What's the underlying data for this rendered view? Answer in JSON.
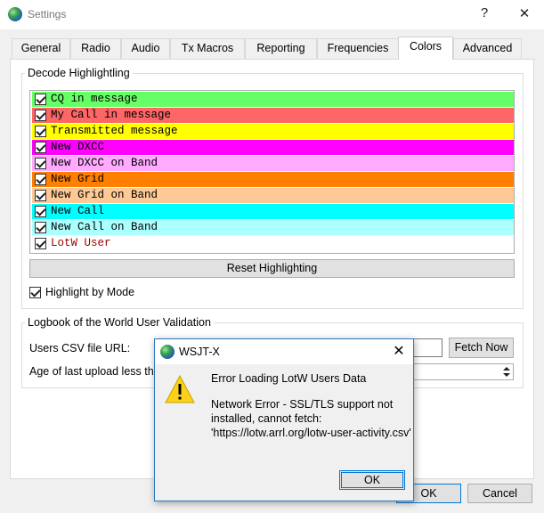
{
  "window": {
    "title": "Settings",
    "help_glyph": "?",
    "close_glyph": "✕"
  },
  "tabs": [
    {
      "label": "General"
    },
    {
      "label": "Radio"
    },
    {
      "label": "Audio"
    },
    {
      "label": "Tx Macros"
    },
    {
      "label": "Reporting"
    },
    {
      "label": "Frequencies"
    },
    {
      "label": "Colors",
      "active": true
    },
    {
      "label": "Advanced"
    }
  ],
  "decode_highlighting": {
    "title": "Decode Highlightling",
    "items": [
      {
        "label": "CQ in message",
        "checked": true,
        "bg": "#66ff66",
        "fg": "#000000"
      },
      {
        "label": "My Call in message",
        "checked": true,
        "bg": "#ff6666",
        "fg": "#000000"
      },
      {
        "label": "Transmitted message",
        "checked": true,
        "bg": "#ffff00",
        "fg": "#000000"
      },
      {
        "label": "New DXCC",
        "checked": true,
        "bg": "#ff00ff",
        "fg": "#000000"
      },
      {
        "label": "New DXCC on Band",
        "checked": true,
        "bg": "#ffaaff",
        "fg": "#000000"
      },
      {
        "label": "New Grid",
        "checked": true,
        "bg": "#ff8000",
        "fg": "#000000"
      },
      {
        "label": "New Grid on Band",
        "checked": true,
        "bg": "#ffc995",
        "fg": "#000000"
      },
      {
        "label": "New Call",
        "checked": true,
        "bg": "#00ffff",
        "fg": "#000000"
      },
      {
        "label": "New Call on Band",
        "checked": true,
        "bg": "#aaffff",
        "fg": "#000000"
      },
      {
        "label": "LotW User",
        "checked": true,
        "bg": "#ffffff",
        "fg": "#990000"
      }
    ],
    "reset_label": "Reset Highlighting",
    "highlight_by_mode_label": "Highlight by Mode",
    "highlight_by_mode_checked": true
  },
  "lotw": {
    "title": "Logbook of the World User Validation",
    "csv_url_label": "Users CSV file URL:",
    "fetch_label": "Fetch Now",
    "age_label": "Age of last upload less th"
  },
  "footer": {
    "ok_label": "OK",
    "cancel_label": "Cancel"
  },
  "dialog": {
    "title": "WSJT-X",
    "heading": "Error Loading LotW Users Data",
    "message": "Network Error - SSL/TLS support not installed, cannot fetch:\n'https://lotw.arrl.org/lotw-user-activity.csv'",
    "ok_label": "OK",
    "close_glyph": "✕"
  }
}
